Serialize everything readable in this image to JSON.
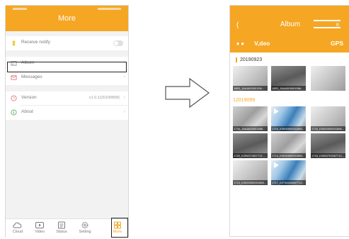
{
  "left_screen": {
    "header_title": "More",
    "settings": {
      "receive_notify": "Receive notify",
      "album": "Album",
      "messages": "Messages",
      "version_label": "Version",
      "version_value": "v1.0.1(20190808)",
      "about": "About"
    },
    "tabs": [
      "Cloud",
      "Video",
      "Status",
      "Setting",
      "More"
    ]
  },
  "right_screen": {
    "back_glyph": "(",
    "title": "Album",
    "top_right_letter": "B",
    "sub_left": "♦ ●",
    "video_label": "V,deo",
    "gps_label": "GPS",
    "date_groups": [
      {
        "date": "20190923",
        "thumbs": [
          {
            "caption": "1863_JAAA0000015N..."
          },
          {
            "caption": "1853_JAAA000001566..."
          },
          {
            "caption": ""
          }
        ]
      },
      {
        "date": "12019099",
        "thumbs": [
          {
            "caption": "1734_JAAA000001566..."
          },
          {
            "caption": "1716_K0000000001566..."
          },
          {
            "caption": "1716_K0000000001566..."
          },
          {
            "caption": "1720_K296371567712..."
          },
          {
            "caption": "1714_K0000000001566..."
          },
          {
            "caption": "1718_K2963791567712..."
          },
          {
            "caption": "1713_K0000000001566..."
          },
          {
            "caption": "1717_K2730415667712..."
          }
        ]
      }
    ]
  },
  "colors": {
    "accent": "#f5a623"
  }
}
